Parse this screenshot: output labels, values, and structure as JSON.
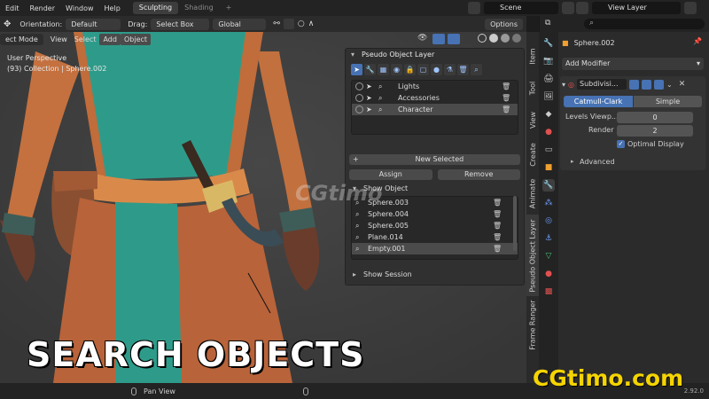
{
  "menu": [
    "Edit",
    "Render",
    "Window",
    "Help"
  ],
  "workspace_tabs": [
    {
      "label": "Sculpting",
      "active": true
    },
    {
      "label": "Shading",
      "active": false
    }
  ],
  "workspace_add": "+",
  "scene": "Scene",
  "view_layer": "View Layer",
  "viewport_header": {
    "orientation_label": "Orientation:",
    "orientation_value": "Default",
    "drag_label": "Drag:",
    "drag_value": "Select Box",
    "transform_value": "Global",
    "options": "Options"
  },
  "viewport_header2": {
    "mode": "ect Mode",
    "menus": [
      "View",
      "Select",
      "Add",
      "Object"
    ]
  },
  "viewport_overlay": {
    "line1": "User Perspective",
    "line2": "(93) Collection | Sphere.002"
  },
  "panel": {
    "title": "Pseudo Object Layer",
    "layers": [
      {
        "name": "Lights",
        "selected": false
      },
      {
        "name": "Accessories",
        "selected": false
      },
      {
        "name": "Character",
        "selected": true
      }
    ],
    "new_selected": "New Selected",
    "assign": "Assign",
    "remove": "Remove",
    "show_object": "Show Object",
    "objects": [
      {
        "name": "Sphere.003",
        "selected": false
      },
      {
        "name": "Sphere.004",
        "selected": false
      },
      {
        "name": "Sphere.005",
        "selected": false
      },
      {
        "name": "Plane.014",
        "selected": false
      },
      {
        "name": "Empty.001",
        "selected": true
      }
    ],
    "show_session": "Show Session"
  },
  "side_tabs": [
    "Item",
    "Tool",
    "View",
    "Create",
    "Animate",
    "Pseudo Object Layer",
    "Frame Ranger"
  ],
  "properties": {
    "object_name": "Sphere.002",
    "add_modifier": "Add Modifier",
    "modifier_name": "Subdivisi...",
    "catmull": "Catmull-Clark",
    "simple": "Simple",
    "levels_label": "Levels Viewp...",
    "levels_value": "0",
    "render_label": "Render",
    "render_value": "2",
    "optimal": "Optimal Display",
    "advanced": "Advanced"
  },
  "status": {
    "pan": "Pan View",
    "version": "2.92.0"
  },
  "caption": "SEARCH OBJECTS",
  "watermark_center": "CGtimo",
  "brand": "CGtimo.com",
  "colors": {
    "accent_blue": "#4772b3",
    "teal": "#2e9b8a",
    "orange": "#c26a3a",
    "brand_yellow": "#f5d400"
  }
}
